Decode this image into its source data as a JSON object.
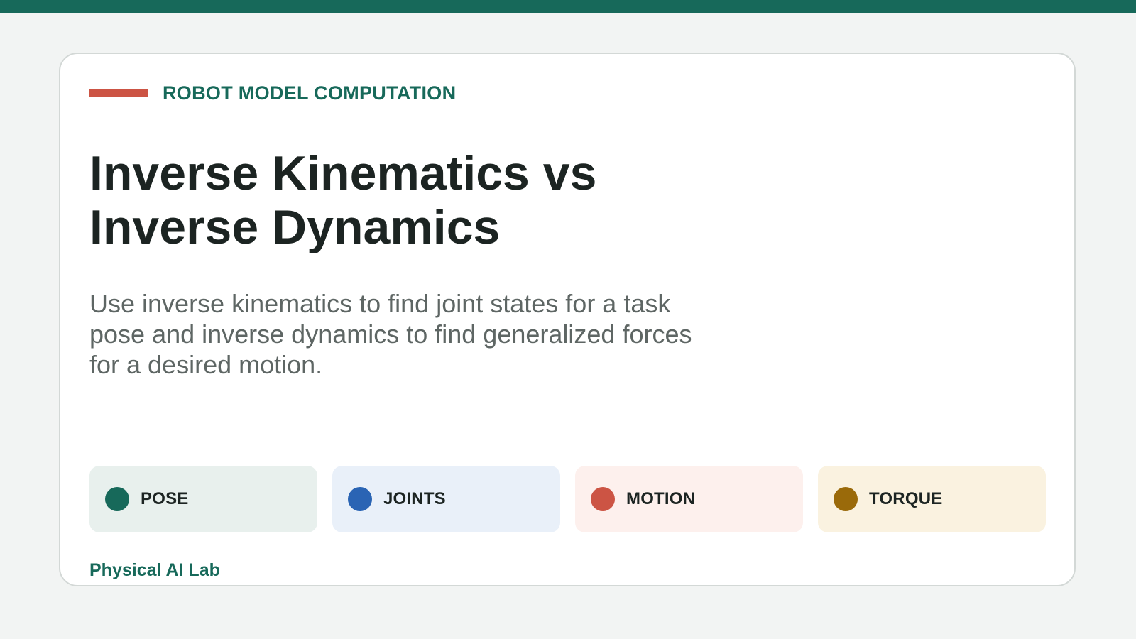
{
  "header": {
    "eyebrow": "ROBOT MODEL COMPUTATION",
    "title_line1": "Inverse Kinematics vs",
    "title_line2": "Inverse Dynamics",
    "subtitle": "Use inverse kinematics to find joint states for a task pose and inverse dynamics to find generalized forces for a desired motion."
  },
  "chips": [
    {
      "label": "POSE",
      "dot_color": "#17695a",
      "bg_color": "#e8f0ed"
    },
    {
      "label": "JOINTS",
      "dot_color": "#2a64b4",
      "bg_color": "#e9f0f9"
    },
    {
      "label": "MOTION",
      "dot_color": "#cc5444",
      "bg_color": "#fdf0ed"
    },
    {
      "label": "TORQUE",
      "dot_color": "#9a6a0a",
      "bg_color": "#faf2e0"
    }
  ],
  "footer": {
    "label": "Physical AI Lab"
  },
  "colors": {
    "accent_green": "#17695a",
    "accent_red": "#cc5444",
    "background": "#f2f4f3"
  }
}
